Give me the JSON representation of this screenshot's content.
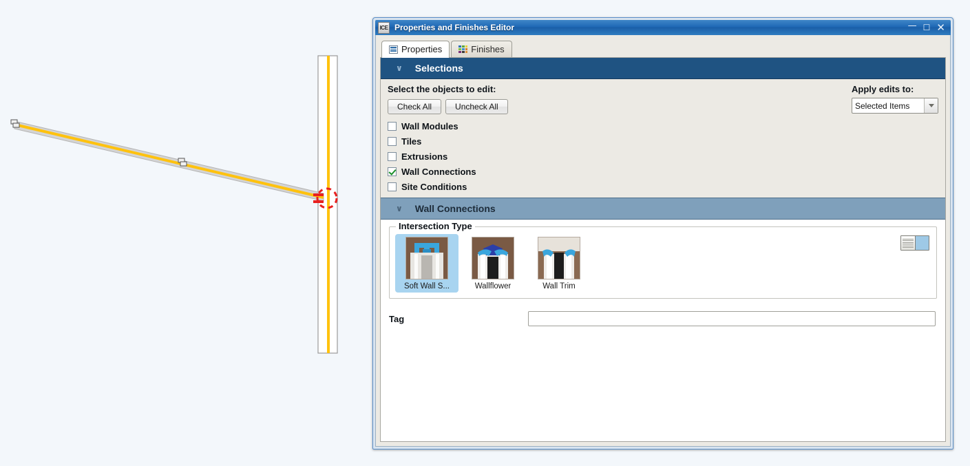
{
  "window": {
    "app_icon_text": "ICE",
    "title": "Properties and Finishes Editor",
    "controls": {
      "minimize": "—",
      "maximize": "☐",
      "close": "✕"
    }
  },
  "tabs": [
    {
      "label": "Properties",
      "icon": "list-icon",
      "active": true
    },
    {
      "label": "Finishes",
      "icon": "color-grid-icon",
      "active": false
    }
  ],
  "selections_section": {
    "header": "Selections",
    "chevron": "∨",
    "prompt": "Select the objects to edit:",
    "check_all_label": "Check All",
    "uncheck_all_label": "Uncheck All",
    "apply_edits_label": "Apply edits to:",
    "apply_edits_value": "Selected Items",
    "checkboxes": [
      {
        "label": "Wall Modules",
        "checked": false
      },
      {
        "label": "Tiles",
        "checked": false
      },
      {
        "label": "Extrusions",
        "checked": false
      },
      {
        "label": "Wall Connections",
        "checked": true
      },
      {
        "label": "Site Conditions",
        "checked": false
      }
    ]
  },
  "wall_connections_section": {
    "header": "Wall Connections",
    "chevron": "∨",
    "intersection_type_legend": "Intersection Type",
    "thumbnails": [
      {
        "caption": "Soft Wall S...",
        "selected": true
      },
      {
        "caption": "Wallflower",
        "selected": false
      },
      {
        "caption": "Wall Trim",
        "selected": false
      }
    ],
    "view_toggle": {
      "list_view_name": "list-view",
      "grid_view_name": "grid-view",
      "active": "grid-view"
    },
    "tag_label": "Tag",
    "tag_value": "",
    "tag_placeholder": ""
  },
  "canvas": {
    "description": "wall-plan-drawing",
    "wall_fill": "#d4d4d4",
    "wall_centerline": "#ffc20e",
    "intersection_marker_color": "#e8201f",
    "background": "#f3f7fb"
  },
  "palette": {
    "title_bar_blue": "#1f69b5",
    "section_primary": "#1f5382",
    "section_secondary": "#7fa0bb",
    "panel_bg": "#eceae4",
    "selection_highlight": "#a8d4f0"
  }
}
